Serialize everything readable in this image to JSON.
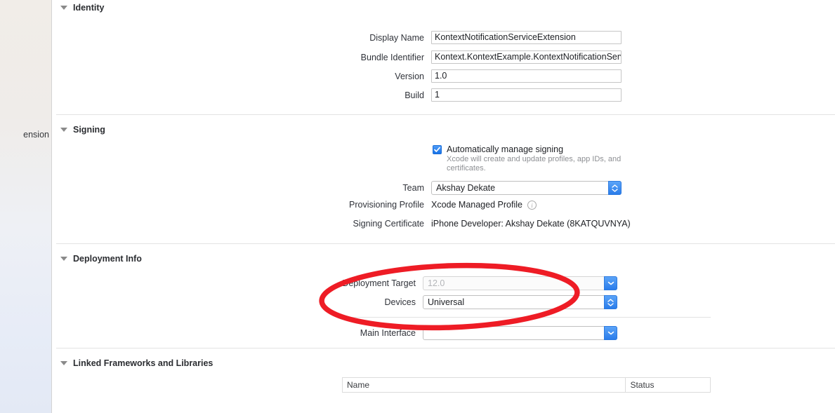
{
  "sidebar": {
    "clipped_item_label": "ension"
  },
  "sections": {
    "identity": {
      "title": "Identity",
      "fields": [
        {
          "label": "Display Name",
          "value": "KontextNotificationServiceExtension"
        },
        {
          "label": "Bundle Identifier",
          "value": "Kontext.KontextExample.KontextNotificationServic"
        },
        {
          "label": "Version",
          "value": "1.0"
        },
        {
          "label": "Build",
          "value": "1"
        }
      ]
    },
    "signing": {
      "title": "Signing",
      "auto_manage": {
        "label": "Automatically manage signing",
        "description": "Xcode will create and update profiles, app IDs, and certificates.",
        "checked": true,
        "check_icon": "checkmark-icon"
      },
      "team": {
        "label": "Team",
        "value": "Akshay Dekate",
        "control": "popup-updown"
      },
      "provisioning_profile": {
        "label": "Provisioning Profile",
        "value": "Xcode Managed Profile",
        "info_icon": "info-icon"
      },
      "signing_certificate": {
        "label": "Signing Certificate",
        "value": "iPhone Developer: Akshay Dekate (8KATQUVNYA)"
      }
    },
    "deployment_info": {
      "title": "Deployment Info",
      "deployment_target": {
        "label": "Deployment Target",
        "value": "12.0",
        "disabled": true,
        "control": "popup-down"
      },
      "devices": {
        "label": "Devices",
        "value": "Universal",
        "control": "popup-updown"
      },
      "main_interface": {
        "label": "Main Interface",
        "value": "",
        "control": "popup-down"
      }
    },
    "linked_frameworks": {
      "title": "Linked Frameworks and Libraries",
      "table": {
        "columns": [
          "Name",
          "Status"
        ],
        "rows": []
      }
    }
  },
  "annotation": {
    "shape": "ellipse",
    "color": "#ee1c25",
    "stroke_width": 7,
    "encircles": [
      "Deployment Target",
      "Devices"
    ]
  },
  "colors": {
    "accent_blue": "#2a7cea",
    "annotation_red": "#ee1c25",
    "label_text": "#30333a",
    "value_text": "#1d1f23",
    "muted_text": "#8d8f93",
    "divider": "#e3e3e3"
  }
}
